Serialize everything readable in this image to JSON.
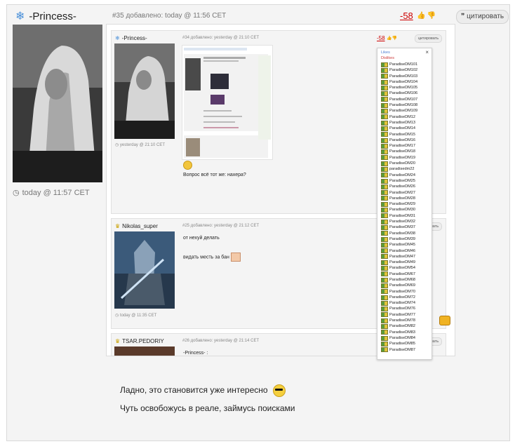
{
  "post": {
    "author": "-Princess-",
    "time": "today @ 11:57 CET",
    "meta": "#35 добавлено: today @ 11:56 CET",
    "rating": "-58",
    "quote_label": "цитировать",
    "comment_line1": "Ладно, это становится уже интересно",
    "comment_line2": "Чуть освобожусь в реале, займусь поисками"
  },
  "screenshot": {
    "posts": [
      {
        "author": "-Princess-",
        "meta": "#34 добавлено: yesterday @ 21:10 CET",
        "time": "yesterday @ 21:10 CET",
        "rating": "-58",
        "quote_label": "цитировать",
        "text": "Вопрос всё тот же: нахера?"
      },
      {
        "author": "Nikolas_super",
        "meta": "#25 добавлено: yesterday @ 21:12 CET",
        "time": "today @ 11:35 CET",
        "quote_label": "цитировать",
        "text1": "от нехуй делать",
        "text2": "видать месть за бан"
      },
      {
        "author": "TSAR.PEDORIY",
        "meta": "#26 добавлено: yesterday @ 21:14 CET",
        "quote_label": "цитировать",
        "text": "-Princess- :"
      }
    ],
    "popup": {
      "close": "×",
      "likes": "Likes",
      "dislikes": "Dislikes",
      "users": [
        "ParadiseDM101",
        "ParadiseDM102",
        "ParadiseDM103",
        "ParadiseDM104",
        "ParadiseDM105",
        "ParadiseDM106",
        "ParadiseDM107",
        "ParadiseDM108",
        "ParadiseDM109",
        "ParadiseDM12",
        "ParadiseDM13",
        "ParadiseDM14",
        "ParadiseDM15",
        "ParadiseDM16",
        "ParadiseDM17",
        "ParadiseDM18",
        "ParadiseDM19",
        "ParadiseDM20",
        "paradisedm22",
        "ParadiseDM24",
        "ParadiseDM25",
        "ParadiseDM26",
        "ParadiseDM27",
        "ParadiseDM28",
        "ParadiseDM29",
        "ParadiseDM30",
        "ParadiseDM31",
        "ParadiseDM32",
        "ParadiseDM37",
        "ParadiseDM38",
        "ParadiseDM39",
        "ParadiseDM45",
        "ParadiseDM46",
        "ParadiseDM47",
        "ParadiseDM49",
        "ParadiseDM54",
        "ParadiseDM67",
        "ParadiseDM68",
        "ParadiseDM69",
        "ParadiseDM70",
        "ParadiseDM72",
        "ParadiseDM74",
        "ParadiseDM76",
        "ParadiseDM77",
        "ParadiseDM78",
        "ParadiseDM82",
        "ParadiseDM83",
        "ParadiseDM84",
        "ParadiseDM85",
        "ParadiseDM87"
      ]
    }
  }
}
